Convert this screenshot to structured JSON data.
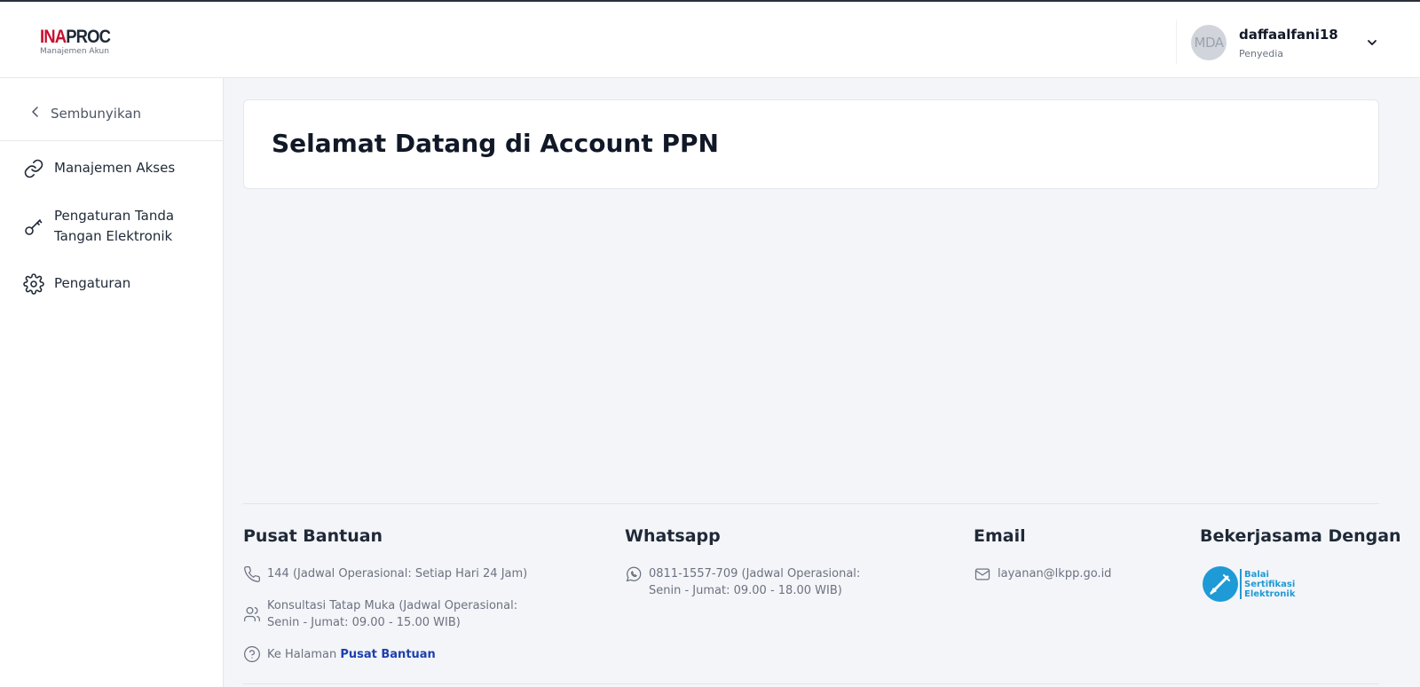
{
  "header": {
    "logo": {
      "brand_red": "INA",
      "brand_dark": "PROC",
      "subtitle": "Manajemen Akun"
    },
    "user": {
      "avatar_initials": "MDA",
      "name": "daffaalfani18",
      "role": "Penyedia",
      "dropdown_icon": "chevron-down-icon"
    }
  },
  "sidebar": {
    "hide_label": "Sembunyikan",
    "hide_icon": "chevron-left-icon",
    "items": [
      {
        "label": "Manajemen Akses",
        "icon": "link-icon"
      },
      {
        "label_line1": "Pengaturan Tanda",
        "label_line2": "Tangan Elektronik",
        "icon": "key-icon"
      },
      {
        "label": "Pengaturan",
        "icon": "gear-icon"
      }
    ]
  },
  "main": {
    "welcome_title": "Selamat Datang di Account PPN"
  },
  "footer": {
    "pusat_bantuan": {
      "title": "Pusat Bantuan",
      "phone": "144 (Jadwal Operasional: Setiap Hari 24 Jam)",
      "meeting_line1": "Konsultasi Tatap Muka (Jadwal Operasional:",
      "meeting_line2": "Senin - Jumat: 09.00 - 15.00 WIB)",
      "link_prefix": "Ke Halaman ",
      "link_label": "Pusat Bantuan"
    },
    "whatsapp": {
      "title": "Whatsapp",
      "line1": "0811-1557-709 (Jadwal Operasional:",
      "line2": "Senin - Jumat: 09.00 - 18.00 WIB)"
    },
    "email": {
      "title": "Email",
      "address": "layanan@lkpp.go.id"
    },
    "partner": {
      "title": "Bekerjasama Dengan",
      "logo_line1": "Balai",
      "logo_line2": "Sertifikasi",
      "logo_line3": "Elektronik"
    }
  },
  "colors": {
    "brand_red": "#c8102e",
    "link_blue": "#1e40af",
    "bse_blue": "#1e9ad6",
    "page_bg": "#f4f5f9"
  }
}
